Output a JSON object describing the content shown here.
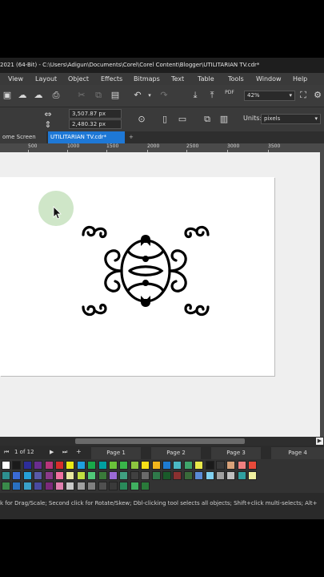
{
  "app": {
    "title": "2021 (64-Bit) - C:\\Users\\Adigun\\Documents\\Corel\\Corel Content\\Blogger\\UTILITARIAN TV.cdr*"
  },
  "menu": {
    "items": [
      {
        "label": "View"
      },
      {
        "label": "Layout"
      },
      {
        "label": "Object"
      },
      {
        "label": "Effects"
      },
      {
        "label": "Bitmaps"
      },
      {
        "label": "Text"
      },
      {
        "label": "Table"
      },
      {
        "label": "Tools"
      },
      {
        "label": "Window"
      },
      {
        "label": "Help"
      }
    ]
  },
  "toolbar": {
    "pdf_label": "PDF",
    "zoom": "42%"
  },
  "propbar": {
    "width_value": "3,507.87 px",
    "height_value": "2,480.32 px",
    "units_label": "Units:",
    "units_value": "pixels"
  },
  "tabs": [
    {
      "label": "ome Screen"
    },
    {
      "label": "UTILITARIAN TV.cdr*"
    },
    {
      "label": "+"
    }
  ],
  "ruler": {
    "ticks": [
      "500",
      "1000",
      "1500",
      "2000",
      "2500",
      "3000",
      "3500"
    ]
  },
  "pages": {
    "counter": "1  of  12",
    "add_label": "+",
    "items": [
      {
        "label": "Page 1"
      },
      {
        "label": "Page 2"
      },
      {
        "label": "Page 3"
      },
      {
        "label": "Page 4"
      }
    ]
  },
  "status": {
    "hint": "k for Drag/Scale; Second click for Rotate/Skew; Dbl-clicking tool selects all objects; Shift+click multi-selects; Alt+"
  },
  "palette": {
    "row1": [
      "#ffffff",
      "#1a1a1a",
      "#2d2d9a",
      "#6a2d8f",
      "#b8357a",
      "#d62d2d",
      "#e8e815",
      "#1ea0e0",
      "#19a84a",
      "#00a0a0",
      "#6ac23a",
      "#39b54a",
      "#8dc63f",
      "#f7e017",
      "#f1b51c",
      "#1e7bd1",
      "#4bb9c4",
      "#3fa56b",
      "#e8e84a",
      "#1a1a1a",
      "#3a3a3a",
      "#d8a27a",
      "#f08080",
      "#e84a3a"
    ],
    "row2": [
      "#2d8f8f",
      "#3a6ad6",
      "#26a0d8",
      "#5a5aa8",
      "#8a3a8a",
      "#f070a0",
      "#e8e8a0",
      "#c0e040",
      "#50c878",
      "#3a7a3a",
      "#9a6ad6",
      "#40a080",
      "#404040",
      "#6a6a6a",
      "#2f7a4a",
      "#1a5a2a",
      "#8a3030",
      "#3a6a3a",
      "#5a8ad6",
      "#80d0f0",
      "#a0a0a0",
      "#c0c0c0",
      "#30a0a0",
      "#f0f0a0"
    ],
    "row3": [
      "#3a8a4a",
      "#2a70c0",
      "#3aa0c8",
      "#4a4aa0",
      "#7a2a7a",
      "#e080b0",
      "#c8c8c8",
      "#a0a0a0",
      "#808080",
      "#505050",
      "#3a3a3a",
      "#2a8a5a",
      "#40b060",
      "#2a7a3a"
    ]
  }
}
